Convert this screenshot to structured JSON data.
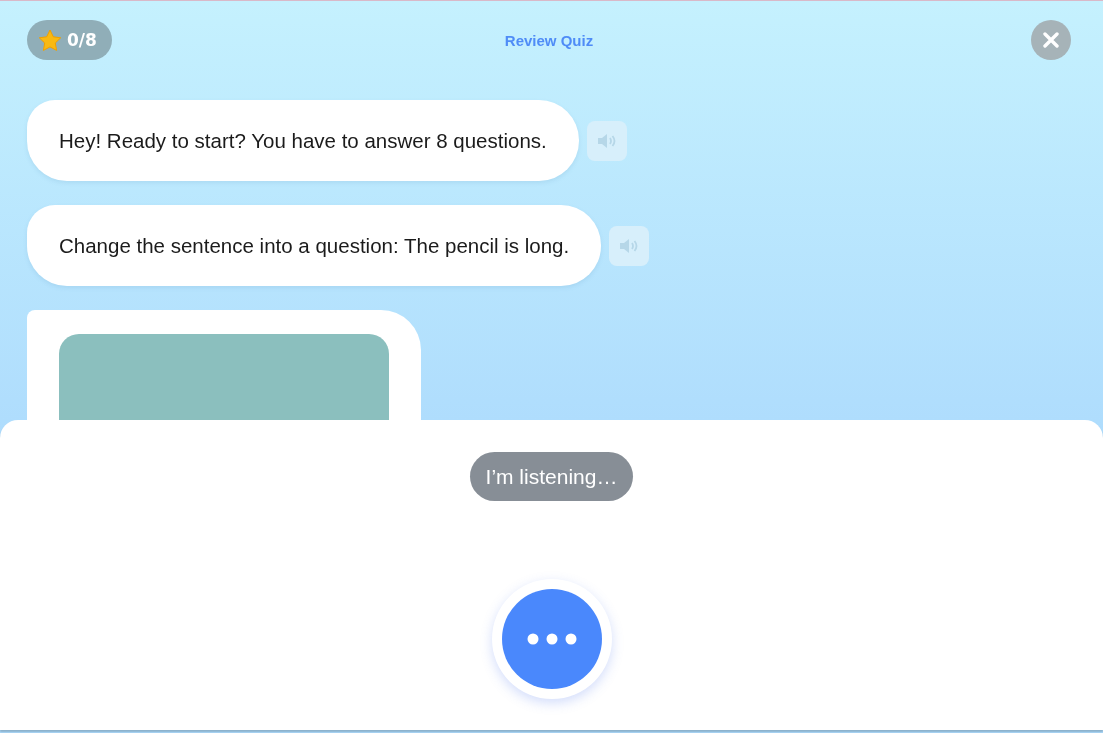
{
  "header": {
    "score": "0/8",
    "title": "Review Quiz"
  },
  "messages": [
    {
      "kind": "text",
      "text": "Hey! Ready to start? You have to answer 8 questions."
    },
    {
      "kind": "text",
      "text": "Change the sentence into a question: The pencil is long."
    },
    {
      "kind": "image"
    }
  ],
  "listening": {
    "status": "I’m listening…"
  }
}
